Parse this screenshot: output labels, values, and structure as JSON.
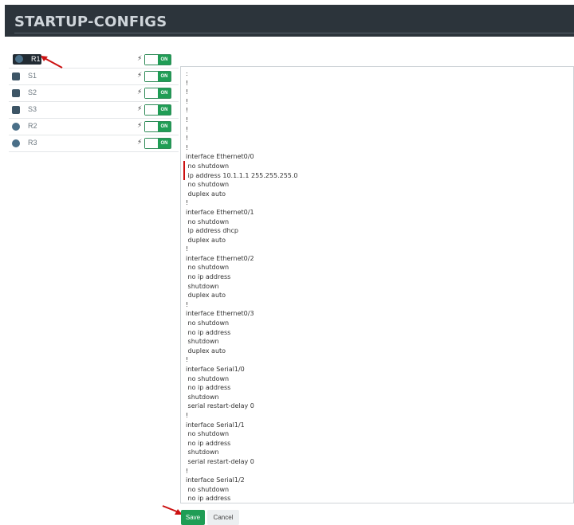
{
  "header": {
    "title": "STARTUP-CONFIGS"
  },
  "nodes": [
    {
      "label": "R1",
      "type": "router",
      "toggle": "ON",
      "selected": true
    },
    {
      "label": "S1",
      "type": "switch",
      "toggle": "ON"
    },
    {
      "label": "S2",
      "type": "switch",
      "toggle": "ON"
    },
    {
      "label": "S3",
      "type": "switch",
      "toggle": "ON"
    },
    {
      "label": "R2",
      "type": "router",
      "toggle": "ON"
    },
    {
      "label": "R3",
      "type": "router",
      "toggle": "ON"
    }
  ],
  "editor": {
    "text": ":\n!\n!\n!\n!\n!\n!\n!\n!\ninterface Ethernet0/0\n no shutdown\n ip address 10.1.1.1 255.255.255.0\n no shutdown\n duplex auto\n!\ninterface Ethernet0/1\n no shutdown\n ip address dhcp\n duplex auto\n!\ninterface Ethernet0/2\n no shutdown\n no ip address\n shutdown\n duplex auto\n!\ninterface Ethernet0/3\n no shutdown\n no ip address\n shutdown\n duplex auto\n!\ninterface Serial1/0\n no shutdown\n no ip address\n shutdown\n serial restart-delay 0\n!\ninterface Serial1/1\n no shutdown\n no ip address\n shutdown\n serial restart-delay 0\n!\ninterface Serial1/2\n no shutdown\n no ip address"
  },
  "buttons": {
    "save": "Save",
    "cancel": "Cancel"
  },
  "colors": {
    "header_bg": "#2c343b",
    "accent": "#1f9d55",
    "annotation": "#cc1111"
  },
  "icons": {
    "toggle_prefix": "bolt-icon",
    "router": "router-icon",
    "switch": "switch-icon"
  }
}
